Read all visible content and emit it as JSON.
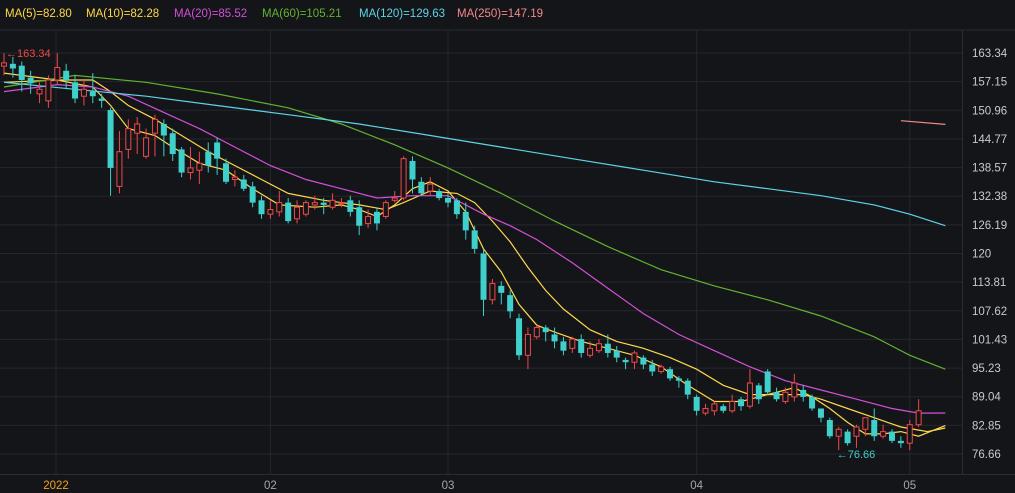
{
  "legend": [
    {
      "label": "MA(5)=82.80",
      "color": "#ffd84a"
    },
    {
      "label": "MA(10)=82.28",
      "color": "#ffd84a"
    },
    {
      "label": "MA(20)=85.52",
      "color": "#d34fd9"
    },
    {
      "label": "MA(60)=105.21",
      "color": "#61b32f"
    },
    {
      "label": "MA(120)=129.63",
      "color": "#5fd4e6"
    },
    {
      "label": "MA(250)=147.19",
      "color": "#f08a8a"
    }
  ],
  "colors": {
    "up": "#f0484a",
    "down": "#3fd0cb",
    "grid": "#25272c",
    "background": "#141519"
  },
  "annotations": {
    "high": "163.34",
    "low": "76.66"
  },
  "chart_data": {
    "type": "candlestick",
    "y_ticks": [
      "163.34",
      "157.15",
      "150.96",
      "144.77",
      "138.57",
      "132.38",
      "126.19",
      "120",
      "113.81",
      "107.62",
      "101.43",
      "95.23",
      "89.04",
      "82.85",
      "76.66"
    ],
    "ylim": [
      76.66,
      163.34
    ],
    "x_labels": [
      {
        "label": "2022",
        "index": 5,
        "highlight": true
      },
      {
        "label": "02",
        "index": 30,
        "highlight": false
      },
      {
        "label": "03",
        "index": 50,
        "highlight": false
      },
      {
        "label": "04",
        "index": 78,
        "highlight": false
      },
      {
        "label": "05",
        "index": 102,
        "highlight": false
      }
    ],
    "candles": [
      [
        160.5,
        161.2,
        163.3,
        158.5
      ],
      [
        161.0,
        160.0,
        162.5,
        158.0
      ],
      [
        160.6,
        157.5,
        161.5,
        155.0
      ],
      [
        158.0,
        156.8,
        159.5,
        154.5
      ],
      [
        154.5,
        155.5,
        157.0,
        152.5
      ],
      [
        153.0,
        157.5,
        158.5,
        151.5
      ],
      [
        157.5,
        160.2,
        163.3,
        156.5
      ],
      [
        159.5,
        157.5,
        161.0,
        155.5
      ],
      [
        157.0,
        153.5,
        158.5,
        152.5
      ],
      [
        154.0,
        155.5,
        157.5,
        152.0
      ],
      [
        155.0,
        154.0,
        159.0,
        152.5
      ],
      [
        153.5,
        153.0,
        154.5,
        151.5
      ],
      [
        151.0,
        138.5,
        151.5,
        132.5
      ],
      [
        134.5,
        142.0,
        146.5,
        133.0
      ],
      [
        142.5,
        147.0,
        149.0,
        140.5
      ],
      [
        146.0,
        148.0,
        149.5,
        141.5
      ],
      [
        141.0,
        145.0,
        147.0,
        140.5
      ],
      [
        146.0,
        149.0,
        150.0,
        141.0
      ],
      [
        148.0,
        145.5,
        149.0,
        141.0
      ],
      [
        146.0,
        141.5,
        147.0,
        140.0
      ],
      [
        142.5,
        137.5,
        143.0,
        136.5
      ],
      [
        137.5,
        138.5,
        143.0,
        136.0
      ],
      [
        138.0,
        139.5,
        142.0,
        135.0
      ],
      [
        142.0,
        139.0,
        144.0,
        137.5
      ],
      [
        144.0,
        140.5,
        145.0,
        137.0
      ],
      [
        139.5,
        135.5,
        140.5,
        135.0
      ],
      [
        136.0,
        136.5,
        138.0,
        134.5
      ],
      [
        136.0,
        134.0,
        137.0,
        133.5
      ],
      [
        134.5,
        131.0,
        135.5,
        130.0
      ],
      [
        131.5,
        128.5,
        132.5,
        127.5
      ],
      [
        128.5,
        129.5,
        131.5,
        127.5
      ],
      [
        129.0,
        131.0,
        133.5,
        128.0
      ],
      [
        131.0,
        127.0,
        132.0,
        126.5
      ],
      [
        127.5,
        130.0,
        131.5,
        126.5
      ],
      [
        128.5,
        131.0,
        131.5,
        128.0
      ],
      [
        130.5,
        131.0,
        132.5,
        129.5
      ],
      [
        131.0,
        130.5,
        132.0,
        128.5
      ],
      [
        130.0,
        131.5,
        133.0,
        129.5
      ],
      [
        131.0,
        131.0,
        132.0,
        130.0
      ],
      [
        131.5,
        129.0,
        132.5,
        128.0
      ],
      [
        130.0,
        126.0,
        131.5,
        124.0
      ],
      [
        126.5,
        128.0,
        129.5,
        125.5
      ],
      [
        129.0,
        126.5,
        130.0,
        125.0
      ],
      [
        128.0,
        131.0,
        131.5,
        127.5
      ],
      [
        131.5,
        132.0,
        133.5,
        131.0
      ],
      [
        132.0,
        140.5,
        141.0,
        131.5
      ],
      [
        140.0,
        136.0,
        141.0,
        133.0
      ],
      [
        135.5,
        133.0,
        136.5,
        132.5
      ],
      [
        133.5,
        135.0,
        136.5,
        132.5
      ],
      [
        133.5,
        132.0,
        134.0,
        131.5
      ],
      [
        132.0,
        131.0,
        133.0,
        130.0
      ],
      [
        131.5,
        128.5,
        132.0,
        127.5
      ],
      [
        129.0,
        125.0,
        131.0,
        123.0
      ],
      [
        125.0,
        121.0,
        126.0,
        120.0
      ],
      [
        120.0,
        110.0,
        121.0,
        106.5
      ],
      [
        110.0,
        113.5,
        114.5,
        109.0
      ],
      [
        113.0,
        111.5,
        114.0,
        109.0
      ],
      [
        111.0,
        107.5,
        112.0,
        106.0
      ],
      [
        106.0,
        98.0,
        107.0,
        97.0
      ],
      [
        98.0,
        102.5,
        104.0,
        95.0
      ],
      [
        102.0,
        104.0,
        104.5,
        101.5
      ],
      [
        104.0,
        103.0,
        104.5,
        101.0
      ],
      [
        102.5,
        101.0,
        104.0,
        99.5
      ],
      [
        101.0,
        99.0,
        102.0,
        98.0
      ],
      [
        99.5,
        101.5,
        102.0,
        98.5
      ],
      [
        101.5,
        98.5,
        102.5,
        97.5
      ],
      [
        98.0,
        99.5,
        101.0,
        97.5
      ],
      [
        99.0,
        100.5,
        101.5,
        98.5
      ],
      [
        100.5,
        98.5,
        102.5,
        97.5
      ],
      [
        99.0,
        97.5,
        100.0,
        96.5
      ],
      [
        97.0,
        96.5,
        97.5,
        95.0
      ],
      [
        96.5,
        98.5,
        99.0,
        95.0
      ],
      [
        97.5,
        96.0,
        98.0,
        95.0
      ],
      [
        96.0,
        94.5,
        97.0,
        93.5
      ],
      [
        94.5,
        95.5,
        96.0,
        94.0
      ],
      [
        95.0,
        93.0,
        95.5,
        92.5
      ],
      [
        93.0,
        92.5,
        93.5,
        91.0
      ],
      [
        92.5,
        89.5,
        93.0,
        88.5
      ],
      [
        89.0,
        86.0,
        89.5,
        85.0
      ],
      [
        85.5,
        86.5,
        87.5,
        85.0
      ],
      [
        86.0,
        87.5,
        88.0,
        85.0
      ],
      [
        87.0,
        86.0,
        87.5,
        85.5
      ],
      [
        86.0,
        88.0,
        89.5,
        85.5
      ],
      [
        88.5,
        87.0,
        89.0,
        86.0
      ],
      [
        87.0,
        92.0,
        95.0,
        86.5
      ],
      [
        91.5,
        88.5,
        92.0,
        87.5
      ],
      [
        94.5,
        90.0,
        95.0,
        89.5
      ],
      [
        90.0,
        88.5,
        91.0,
        88.0
      ],
      [
        88.0,
        90.0,
        91.0,
        87.5
      ],
      [
        89.0,
        92.0,
        94.0,
        88.0
      ],
      [
        90.5,
        89.0,
        91.5,
        88.0
      ],
      [
        89.0,
        86.5,
        89.5,
        86.0
      ],
      [
        86.5,
        84.5,
        86.5,
        83.5
      ],
      [
        84.0,
        80.5,
        84.5,
        80.0
      ],
      [
        80.5,
        82.0,
        82.5,
        77.5
      ],
      [
        81.5,
        79.0,
        82.0,
        78.5
      ],
      [
        80.5,
        82.5,
        83.0,
        78.0
      ],
      [
        82.0,
        84.5,
        84.5,
        80.5
      ],
      [
        84.0,
        80.5,
        86.5,
        79.5
      ],
      [
        80.5,
        81.5,
        83.0,
        80.0
      ],
      [
        81.5,
        79.5,
        82.0,
        79.0
      ],
      [
        79.5,
        79.0,
        80.5,
        78.0
      ],
      [
        79.0,
        83.0,
        84.0,
        77.5
      ],
      [
        83.0,
        86.0,
        88.5,
        82.5
      ]
    ],
    "ma": [
      {
        "name": "MA(5)",
        "color": "#ffd84a",
        "values": [
          [
            0,
            159.0
          ],
          [
            6,
            157.5
          ],
          [
            10,
            156.0
          ],
          [
            12,
            152.0
          ],
          [
            14,
            147.0
          ],
          [
            17,
            145.5
          ],
          [
            19,
            143.0
          ],
          [
            22,
            139.5
          ],
          [
            25,
            138.0
          ],
          [
            28,
            134.0
          ],
          [
            31,
            130.5
          ],
          [
            35,
            130.0
          ],
          [
            38,
            130.5
          ],
          [
            40,
            129.5
          ],
          [
            42,
            128.0
          ],
          [
            44,
            130.5
          ],
          [
            46,
            134.0
          ],
          [
            48,
            135.5
          ],
          [
            50,
            133.5
          ],
          [
            52,
            129.0
          ],
          [
            54,
            121.0
          ],
          [
            56,
            116.0
          ],
          [
            58,
            109.0
          ],
          [
            60,
            104.5
          ],
          [
            62,
            103.0
          ],
          [
            65,
            101.0
          ],
          [
            68,
            99.5
          ],
          [
            71,
            98.0
          ],
          [
            74,
            95.5
          ],
          [
            77,
            91.5
          ],
          [
            80,
            88.0
          ],
          [
            83,
            88.0
          ],
          [
            86,
            89.5
          ],
          [
            89,
            91.0
          ],
          [
            91,
            89.0
          ],
          [
            93,
            86.5
          ],
          [
            95,
            83.5
          ],
          [
            97,
            81.0
          ],
          [
            99,
            81.0
          ],
          [
            101,
            81.5
          ],
          [
            103,
            80.5
          ],
          [
            106,
            82.8
          ]
        ]
      },
      {
        "name": "MA(10)",
        "color": "#ffd84a",
        "values": [
          [
            0,
            157.0
          ],
          [
            6,
            157.5
          ],
          [
            10,
            157.5
          ],
          [
            12,
            155.0
          ],
          [
            14,
            152.0
          ],
          [
            17,
            149.0
          ],
          [
            20,
            145.5
          ],
          [
            23,
            142.0
          ],
          [
            26,
            139.0
          ],
          [
            29,
            136.0
          ],
          [
            32,
            133.0
          ],
          [
            36,
            131.5
          ],
          [
            40,
            130.5
          ],
          [
            43,
            129.5
          ],
          [
            45,
            131.0
          ],
          [
            48,
            133.5
          ],
          [
            51,
            133.0
          ],
          [
            53,
            131.0
          ],
          [
            55,
            127.0
          ],
          [
            57,
            122.5
          ],
          [
            59,
            117.0
          ],
          [
            61,
            112.0
          ],
          [
            63,
            108.0
          ],
          [
            66,
            103.5
          ],
          [
            69,
            101.0
          ],
          [
            72,
            99.5
          ],
          [
            75,
            97.5
          ],
          [
            78,
            95.0
          ],
          [
            81,
            91.5
          ],
          [
            84,
            89.5
          ],
          [
            87,
            89.5
          ],
          [
            90,
            89.5
          ],
          [
            92,
            88.5
          ],
          [
            95,
            86.5
          ],
          [
            98,
            84.5
          ],
          [
            101,
            82.5
          ],
          [
            104,
            81.5
          ],
          [
            106,
            82.28
          ]
        ]
      },
      {
        "name": "MA(20)",
        "color": "#d34fd9",
        "values": [
          [
            0,
            155.0
          ],
          [
            6,
            156.5
          ],
          [
            10,
            156.0
          ],
          [
            14,
            154.0
          ],
          [
            18,
            150.5
          ],
          [
            22,
            147.0
          ],
          [
            26,
            143.0
          ],
          [
            30,
            139.0
          ],
          [
            34,
            136.0
          ],
          [
            38,
            134.0
          ],
          [
            42,
            132.0
          ],
          [
            46,
            132.5
          ],
          [
            50,
            132.5
          ],
          [
            54,
            128.5
          ],
          [
            57,
            126.0
          ],
          [
            60,
            123.0
          ],
          [
            64,
            118.0
          ],
          [
            68,
            112.5
          ],
          [
            72,
            107.0
          ],
          [
            76,
            102.5
          ],
          [
            80,
            99.0
          ],
          [
            84,
            95.5
          ],
          [
            88,
            92.5
          ],
          [
            92,
            90.5
          ],
          [
            96,
            88.5
          ],
          [
            100,
            86.5
          ],
          [
            103,
            85.5
          ],
          [
            106,
            85.52
          ]
        ]
      },
      {
        "name": "MA(60)",
        "color": "#61b32f",
        "values": [
          [
            0,
            156.0
          ],
          [
            8,
            158.5
          ],
          [
            16,
            157.0
          ],
          [
            24,
            154.5
          ],
          [
            32,
            151.5
          ],
          [
            38,
            148.0
          ],
          [
            44,
            143.5
          ],
          [
            50,
            138.5
          ],
          [
            56,
            133.0
          ],
          [
            62,
            127.0
          ],
          [
            68,
            121.5
          ],
          [
            74,
            116.5
          ],
          [
            80,
            113.0
          ],
          [
            86,
            110.0
          ],
          [
            92,
            106.5
          ],
          [
            98,
            102.0
          ],
          [
            102,
            98.0
          ],
          [
            106,
            95.0
          ]
        ]
      },
      {
        "name": "MA(120)",
        "color": "#5fd4e6",
        "values": [
          [
            0,
            157.0
          ],
          [
            8,
            155.5
          ],
          [
            16,
            154.0
          ],
          [
            24,
            152.0
          ],
          [
            32,
            150.0
          ],
          [
            40,
            148.0
          ],
          [
            48,
            145.5
          ],
          [
            56,
            143.0
          ],
          [
            64,
            140.5
          ],
          [
            72,
            138.0
          ],
          [
            80,
            135.5
          ],
          [
            86,
            134.0
          ],
          [
            92,
            132.5
          ],
          [
            98,
            130.5
          ],
          [
            102,
            128.5
          ],
          [
            106,
            126.0
          ]
        ]
      },
      {
        "name": "MA(250)",
        "color": "#f08a8a",
        "values": [
          [
            101,
            148.7
          ],
          [
            106,
            147.9
          ]
        ]
      }
    ]
  }
}
